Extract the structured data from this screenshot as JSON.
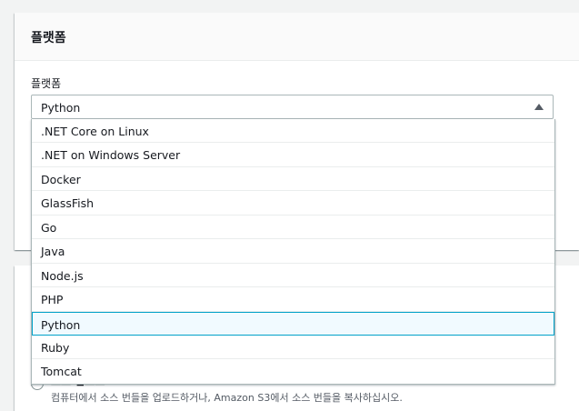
{
  "panel_platform": {
    "header": "플랫폼",
    "field_label": "플랫폼",
    "selected_value": "Python",
    "options": [
      ".NET Core on Linux",
      ".NET on Windows Server",
      "Docker",
      "GlassFish",
      "Go",
      "Java",
      "Node.js",
      "PHP",
      "Python",
      "Ruby",
      "Tomcat"
    ]
  },
  "panel_code": {
    "radio_label": "코드 업로드",
    "helper": "컴퓨터에서 소스 번들을 업로드하거나, Amazon S3에서 소스 번들을 복사하십시오."
  },
  "colors": {
    "accent": "#00a1c9",
    "selected_bg": "#f1faff",
    "border": "#aab7b8",
    "page_bg": "#f2f3f3"
  },
  "icons": {
    "select_caret": "caret-up-icon"
  }
}
